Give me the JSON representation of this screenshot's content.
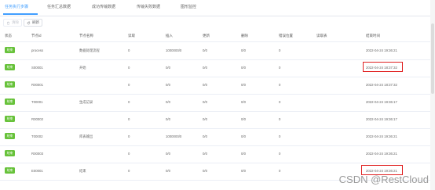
{
  "tabs": [
    {
      "label": "任务执行步骤"
    },
    {
      "label": "任务汇总数据"
    },
    {
      "label": "成功传输数据"
    },
    {
      "label": "传输失败数据"
    },
    {
      "label": "图形监控"
    }
  ],
  "toolbar": {
    "clear_label": "清除",
    "refresh_label": "刷新"
  },
  "columns": [
    "状态",
    "节点id",
    "节点名称",
    "读取",
    "插入",
    "更新",
    "删除",
    "错误位置",
    "读取表",
    "结束时间"
  ],
  "rows": [
    {
      "status": "结束",
      "id": "process",
      "name": "数据处理流程",
      "read": "0",
      "insert": "1000000/0",
      "update": "0/0",
      "delete": "0/0",
      "errpos": "0",
      "readtable": "",
      "endtime": "2022-04-24 19:36:21"
    },
    {
      "status": "结束",
      "id": "S00001",
      "name": "开始",
      "read": "0",
      "insert": "0/0",
      "update": "0/0",
      "delete": "0/0",
      "errpos": "0",
      "readtable": "",
      "endtime": "2022-04-24 18:37:32"
    },
    {
      "status": "结束",
      "id": "R00001",
      "name": "",
      "read": "0",
      "insert": "0/0",
      "update": "0/0",
      "delete": "0/0",
      "errpos": "0",
      "readtable": "",
      "endtime": "2022-04-24 18:37:32"
    },
    {
      "status": "结束",
      "id": "T00001",
      "name": "生成记录",
      "read": "0",
      "insert": "0/0",
      "update": "0/0",
      "delete": "0/0",
      "errpos": "0",
      "readtable": "",
      "endtime": "2022-04-24 19:36:17"
    },
    {
      "status": "结束",
      "id": "R00002",
      "name": "",
      "read": "0",
      "insert": "0/0",
      "update": "0/0",
      "delete": "0/0",
      "errpos": "0",
      "readtable": "",
      "endtime": "2022-04-24 19:36:17"
    },
    {
      "status": "结束",
      "id": "T00002",
      "name": "库表输出",
      "read": "0",
      "insert": "1000000/0",
      "update": "0/0",
      "delete": "0/0",
      "errpos": "0",
      "readtable": "",
      "endtime": "2022-04-24 19:36:21"
    },
    {
      "status": "结束",
      "id": "R00003",
      "name": "",
      "read": "0",
      "insert": "0/0",
      "update": "0/0",
      "delete": "0/0",
      "errpos": "0",
      "readtable": "",
      "endtime": "2022-04-24 19:36:21"
    },
    {
      "status": "结束",
      "id": "E00001",
      "name": "结束",
      "read": "0",
      "insert": "0/0",
      "update": "0/0",
      "delete": "0/0",
      "errpos": "0",
      "readtable": "",
      "endtime": "2022-04-24 19:36:21"
    }
  ],
  "watermark": "CSDN @RestCloud",
  "colors": {
    "accent": "#409eff",
    "status_badge": "#67c23a",
    "highlight": "#e02020"
  }
}
